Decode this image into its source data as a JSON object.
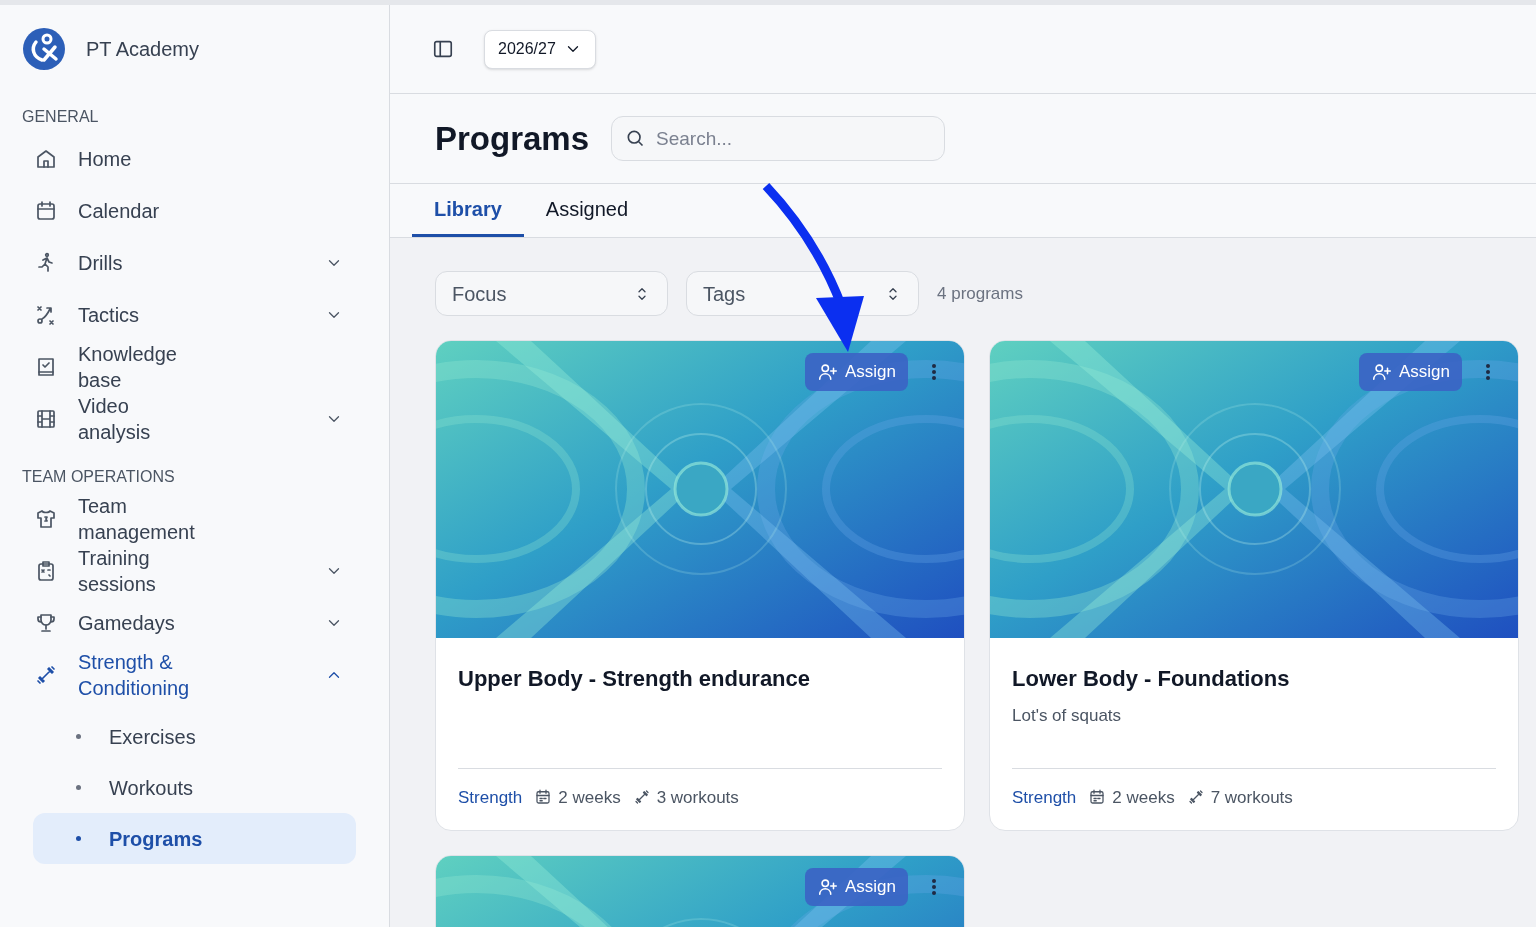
{
  "brand": {
    "name": "PT Academy"
  },
  "sidebar": {
    "sections": [
      {
        "title": "GENERAL",
        "items": [
          {
            "label": "Home",
            "kind": "link",
            "selected": false
          },
          {
            "label": "Calendar",
            "kind": "link",
            "selected": false
          },
          {
            "label": "Drills",
            "kind": "group",
            "expanded": false,
            "selected": false
          },
          {
            "label": "Tactics",
            "kind": "group",
            "expanded": false,
            "selected": false
          },
          {
            "label": "Knowledge base",
            "kind": "link",
            "selected": false
          },
          {
            "label": "Video analysis",
            "kind": "group",
            "expanded": false,
            "selected": false
          }
        ]
      },
      {
        "title": "TEAM OPERATIONS",
        "items": [
          {
            "label": "Team management",
            "kind": "link",
            "selected": false
          },
          {
            "label": "Training sessions",
            "kind": "group",
            "expanded": false,
            "selected": false
          },
          {
            "label": "Gamedays",
            "kind": "group",
            "expanded": false,
            "selected": false
          },
          {
            "label": "Strength & Conditioning",
            "kind": "group",
            "expanded": true,
            "selected": true,
            "children": [
              {
                "label": "Exercises",
                "selected": false
              },
              {
                "label": "Workouts",
                "selected": false
              },
              {
                "label": "Programs",
                "selected": true
              }
            ]
          }
        ]
      }
    ]
  },
  "season": {
    "value": "2026/27"
  },
  "page": {
    "title": "Programs",
    "search": {
      "placeholder": "Search..."
    }
  },
  "tabs": [
    {
      "label": "Library",
      "selected": true
    },
    {
      "label": "Assigned",
      "selected": false
    }
  ],
  "filters": [
    {
      "label": "Focus"
    },
    {
      "label": "Tags"
    }
  ],
  "count": "4 programs",
  "cards": [
    {
      "assign": "Assign",
      "title": "Upper Body - Strength endurance",
      "focus": "Strength",
      "duration": "2 weeks",
      "workouts": "3 workouts"
    },
    {
      "assign": "Assign",
      "title": "Lower Body - Foundations",
      "description": "Lot's of squats",
      "focus": "Strength",
      "duration": "2 weeks",
      "workouts": "7 workouts"
    },
    {
      "assign": "Assign"
    }
  ]
}
